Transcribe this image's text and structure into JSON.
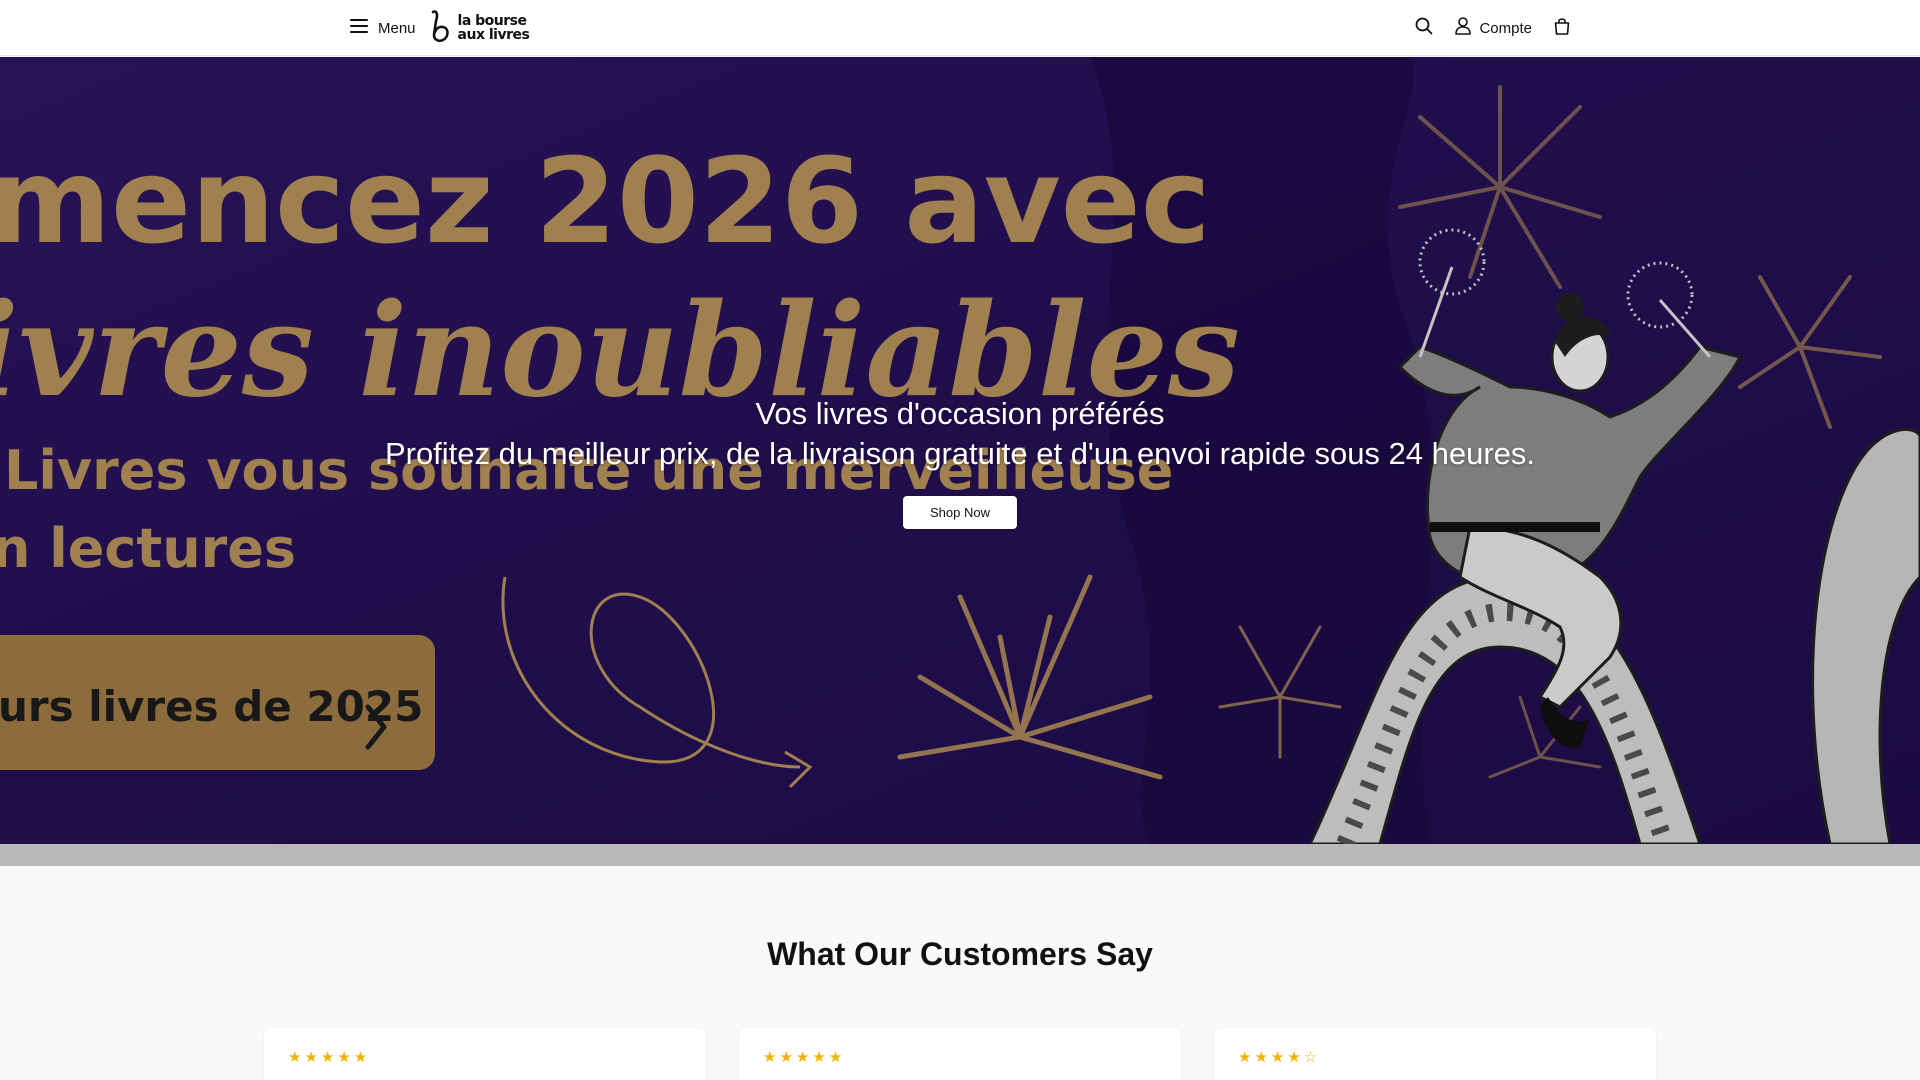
{
  "header": {
    "menu_label": "Menu",
    "logo_line1": "la bourse",
    "logo_line2": "aux livres",
    "account_label": "Compte"
  },
  "hero": {
    "banner_line1": "mencez 2026 avec",
    "banner_line2": "ivres inoubliables",
    "banner_line3": "Livres vous souhaite une merveilleuse",
    "banner_line4": "n lectures",
    "banner_button": "urs livres de 2025",
    "title": "Vos livres d'occasion préférés",
    "subtitle": "Profitez du meilleur prix, de la livraison gratuite et d'un envoi rapide sous 24 heures.",
    "cta": "Shop Now"
  },
  "reviews": {
    "title": "What Our Customers Say",
    "cards": [
      {
        "stars": "★★★★★",
        "rating": 5
      },
      {
        "stars": "★★★★★",
        "rating": 5
      },
      {
        "stars": "★★★★☆",
        "rating": 4
      }
    ]
  },
  "colors": {
    "hero_purple": "#2f1562",
    "gold": "#b8925a",
    "star": "#f0b400"
  },
  "icons": [
    "hamburger-icon",
    "logo-b-icon",
    "search-icon",
    "user-icon",
    "bag-icon"
  ]
}
